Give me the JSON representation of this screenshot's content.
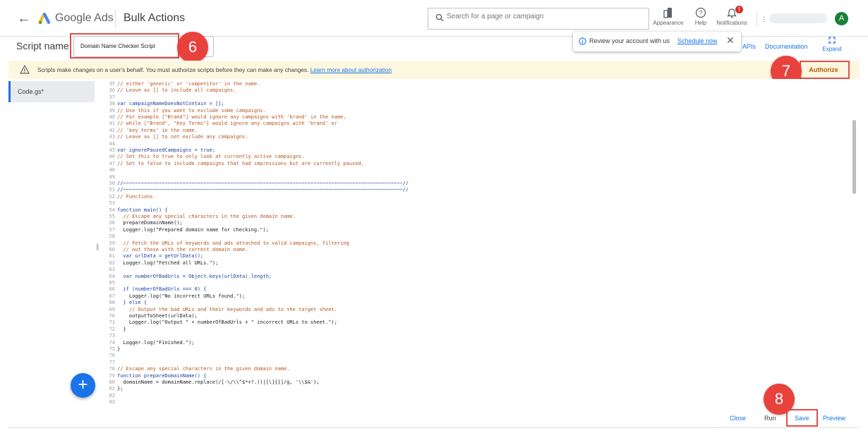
{
  "header": {
    "brand": "Google Ads",
    "page_title": "Bulk Actions",
    "search_placeholder": "Search for a page or campaign",
    "tools": [
      {
        "label": "Appearance",
        "icon": "appearance-icon"
      },
      {
        "label": "Help",
        "icon": "help-icon"
      },
      {
        "label": "Notifications",
        "icon": "bell-icon",
        "badge": "!"
      }
    ],
    "account_separator": "⋮",
    "avatar_initial": "A"
  },
  "script_bar": {
    "label": "Script name",
    "script_name_value": "Domain Name Checker Script",
    "apis_link": "APIs",
    "documentation_link": "Documentation",
    "expand_label": "Expand"
  },
  "toast": {
    "message": "Review your account with us",
    "action": "Schedule now"
  },
  "banner": {
    "message": "Scripts make changes on a user's behalf. You must authorize scripts before they can make any changes.",
    "link": "Learn more about authorization",
    "authorize_button": "Authorize"
  },
  "files": [
    {
      "name": "Code.gs*"
    }
  ],
  "editor": {
    "lines": [
      {
        "n": "35",
        "code": "// either 'generic' or 'competitor' in the name.",
        "type": "cm"
      },
      {
        "n": "36",
        "code": "// Leave as [] to include all campaigns.",
        "type": "cm"
      },
      {
        "n": "37",
        "code": "",
        "type": "tx"
      },
      {
        "n": "38",
        "code": "var campaignNameDoesNotContain = [];",
        "type": "kw"
      },
      {
        "n": "39",
        "code": "// Use this if you want to exclude some campaigns.",
        "type": "cm"
      },
      {
        "n": "40",
        "code": "// For example [\"Brand\"] would ignore any campaigns with 'brand' in the name,",
        "type": "cm"
      },
      {
        "n": "41",
        "code": "// while [\"Brand\", \"Key Terms\"] would ignore any campaigns with 'brand' or",
        "type": "cm"
      },
      {
        "n": "42",
        "code": "// 'key terms' in the name.",
        "type": "cm"
      },
      {
        "n": "43",
        "code": "// Leave as [] to not exclude any campaigns.",
        "type": "cm"
      },
      {
        "n": "44",
        "code": "",
        "type": "tx"
      },
      {
        "n": "45",
        "code": "var ignorePausedCampaigns = true;",
        "type": "kw"
      },
      {
        "n": "46",
        "code": "// Set this to true to only look at currently active campaigns.",
        "type": "cm"
      },
      {
        "n": "47",
        "code": "// Set to false to include campaigns that had impressions but are currently paused.",
        "type": "cm"
      },
      {
        "n": "48",
        "code": "",
        "type": "tx"
      },
      {
        "n": "49",
        "code": "",
        "type": "tx"
      },
      {
        "n": "50",
        "code": "//~~~~~~~~~~~~~~~~~~~~~~~~~~~~~~~~~~~~~~~~~~~~~~~~~~~~~~~~~~~~~~~~~~~~~~~~~~~~~~~~~~~~~~~~~~~~~~//",
        "type": "kw"
      },
      {
        "n": "51",
        "code": "//~~~~~~~~~~~~~~~~~~~~~~~~~~~~~~~~~~~~~~~~~~~~~~~~~~~~~~~~~~~~~~~~~~~~~~~~~~~~~~~~~~~~~~~~~~~~~~//",
        "type": "kw"
      },
      {
        "n": "52",
        "code": "// Functions",
        "type": "cm"
      },
      {
        "n": "53",
        "code": "",
        "type": "tx"
      },
      {
        "n": "54",
        "code": "function main() {",
        "type": "kw"
      },
      {
        "n": "55",
        "code": "  // Escape any special characters in the given domain name.",
        "type": "cm"
      },
      {
        "n": "56",
        "code": "  prepareDomainName();",
        "type": "tx"
      },
      {
        "n": "57",
        "code": "  Logger.log(\"Prepared domain name for checking.\");",
        "type": "tx"
      },
      {
        "n": "58",
        "code": "",
        "type": "tx"
      },
      {
        "n": "59",
        "code": "  // Fetch the URLs of keywords and ads attached to valid campaigns, filtering",
        "type": "cm"
      },
      {
        "n": "60",
        "code": "  // out those with the correct domain name.",
        "type": "cm"
      },
      {
        "n": "61",
        "code": "  var urlData = getUrlData();",
        "type": "kw"
      },
      {
        "n": "62",
        "code": "  Logger.log(\"Fetched all URLs.\");",
        "type": "tx"
      },
      {
        "n": "63",
        "code": "",
        "type": "tx"
      },
      {
        "n": "64",
        "code": "  var numberOfBadUrls = Object.keys(urlData).length;",
        "type": "kw"
      },
      {
        "n": "65",
        "code": "",
        "type": "tx"
      },
      {
        "n": "66",
        "code": "  if (numberOfBadUrls === 0) {",
        "type": "kw"
      },
      {
        "n": "67",
        "code": "    Logger.log(\"No incorrect URLs found.\");",
        "type": "tx"
      },
      {
        "n": "68",
        "code": "  } else {",
        "type": "kw"
      },
      {
        "n": "69",
        "code": "    // Output the bad URLs and their keywords and ads to the target sheet.",
        "type": "cm"
      },
      {
        "n": "70",
        "code": "    outputToSheet(urlData);",
        "type": "tx"
      },
      {
        "n": "71",
        "code": "    Logger.log(\"Output \" + numberOfBadUrls + \" incorrect URLs to sheet.\");",
        "type": "tx"
      },
      {
        "n": "72",
        "code": "  }",
        "type": "tx"
      },
      {
        "n": "73",
        "code": "",
        "type": "tx"
      },
      {
        "n": "74",
        "code": "  Logger.log(\"Finished.\");",
        "type": "tx"
      },
      {
        "n": "75",
        "code": "}",
        "type": "tx"
      },
      {
        "n": "76",
        "code": "",
        "type": "tx"
      },
      {
        "n": "77",
        "code": "",
        "type": "tx"
      },
      {
        "n": "78",
        "code": "// Escape any special characters in the given domain name.",
        "type": "cm"
      },
      {
        "n": "79",
        "code": "function prepareDomainName() {",
        "type": "kw"
      },
      {
        "n": "80",
        "code": "  domainName = domainName.replace(/[-\\/\\\\^$*+?.()|[\\]{}]/g, '\\\\$&');",
        "type": "tx"
      },
      {
        "n": "81",
        "code": "};",
        "type": "tx"
      },
      {
        "n": "82",
        "code": "",
        "type": "tx"
      },
      {
        "n": "83",
        "code": "",
        "type": "tx"
      }
    ]
  },
  "actions": {
    "close": "Close",
    "run": "Run",
    "save": "Save",
    "preview": "Preview"
  },
  "markers": [
    "6",
    "7",
    "8"
  ],
  "colors": {
    "accent": "#1a73e8",
    "marker": "#e9423d",
    "banner": "#fef7e0",
    "authorize": "#b06000"
  }
}
